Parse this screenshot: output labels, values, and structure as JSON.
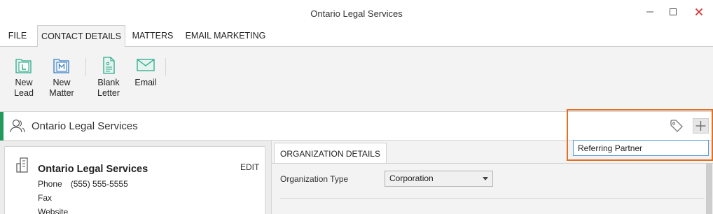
{
  "window": {
    "title": "Ontario Legal Services"
  },
  "menu_tabs": [
    {
      "label": "FILE",
      "active": false
    },
    {
      "label": "CONTACT DETAILS",
      "active": true
    },
    {
      "label": "MATTERS",
      "active": false
    },
    {
      "label": "EMAIL MARKETING",
      "active": false
    }
  ],
  "ribbon": {
    "buttons": [
      {
        "line1": "New",
        "line2": "Lead",
        "icon": "new-lead-icon"
      },
      {
        "line1": "New",
        "line2": "Matter",
        "icon": "new-matter-icon"
      },
      {
        "line1": "Blank",
        "line2": "Letter",
        "icon": "blank-letter-icon"
      },
      {
        "line1": "Email",
        "line2": "",
        "icon": "email-icon"
      }
    ]
  },
  "contact_bar": {
    "name": "Ontario Legal Services",
    "icon": "contact-person-icon"
  },
  "tags": {
    "input_value": "Referring Partner",
    "icon": "tag-icon",
    "add_icon": "plus-icon"
  },
  "card": {
    "name": "Ontario Legal Services",
    "edit_label": "EDIT",
    "phone_label": "Phone",
    "phone_value": "(555) 555-5555",
    "fax_label": "Fax",
    "website_label": "Website",
    "icon": "building-icon"
  },
  "details": {
    "tab_label": "ORGANIZATION DETAILS",
    "org_type_label": "Organization Type",
    "org_type_value": "Corporation"
  },
  "colors": {
    "accent": "#1e9a5b",
    "highlight": "#e36f21",
    "icon_teal": "#2fa98a",
    "icon_blue": "#3b7fc4",
    "close_red": "#d0312d"
  }
}
